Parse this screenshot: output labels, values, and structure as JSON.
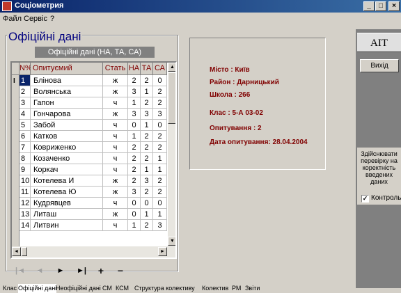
{
  "window": {
    "title": "Соціометрия",
    "min": "_",
    "max": "□",
    "close": "×"
  },
  "menu": [
    "Файл",
    "Сервіс",
    "?"
  ],
  "official": {
    "group_title": "Офіційні дані",
    "subtitle": "Офіційні дані (НА, ТА, СА)",
    "columns": [
      "N%",
      "Опитуємий",
      "Стать",
      "НА",
      "ТА",
      "СА"
    ],
    "current_marker": "I",
    "rows": [
      [
        "1",
        "Блінова",
        "ж",
        "2",
        "2",
        "0"
      ],
      [
        "2",
        "Волянська",
        "ж",
        "3",
        "1",
        "2"
      ],
      [
        "3",
        "Гапон",
        "ч",
        "1",
        "2",
        "2"
      ],
      [
        "4",
        "Гончарова",
        "ж",
        "3",
        "3",
        "3"
      ],
      [
        "5",
        "Забой",
        "ч",
        "0",
        "1",
        "0"
      ],
      [
        "6",
        "Катков",
        "ч",
        "1",
        "2",
        "2"
      ],
      [
        "7",
        "Ковриженко",
        "ч",
        "2",
        "2",
        "2"
      ],
      [
        "8",
        "Козаченко",
        "ч",
        "2",
        "2",
        "1"
      ],
      [
        "9",
        "Коркач",
        "ч",
        "2",
        "1",
        "1"
      ],
      [
        "10",
        "Котелева И",
        "ж",
        "2",
        "3",
        "2"
      ],
      [
        "11",
        "Котелева Ю",
        "ж",
        "3",
        "2",
        "2"
      ],
      [
        "12",
        "Кудрявцев",
        "ч",
        "0",
        "0",
        "0"
      ],
      [
        "13",
        "Литаш",
        "ж",
        "0",
        "1",
        "1"
      ],
      [
        "14",
        "Литвин",
        "ч",
        "1",
        "2",
        "3"
      ]
    ],
    "selected_row": 0
  },
  "navigator": [
    "|◄",
    "◄",
    "►",
    "►|",
    "+",
    "−"
  ],
  "info": {
    "city": "Місто : Київ",
    "district": "Район : Дарницький",
    "school": "Школа : 266",
    "class": "Клас : 5-А 03-02",
    "surveyed": "Опитування : 2",
    "date": "Дата опитування: 28.04.2004"
  },
  "side": {
    "logo": "AIT",
    "exit": "Вихід",
    "verify_text": "Здійснювати перевірку на коректність введених даних",
    "control_label": "Контроль",
    "control_check": "✓"
  },
  "tabs": [
    "Клас",
    "Офіційні дані",
    "Неофіційні дані",
    "СМ",
    "КСМ",
    "Структура колективу",
    "Колектив",
    "РМ",
    "Звіти"
  ],
  "active_tab": 1,
  "colors": {
    "title_bar": "#0a246a",
    "group_title": "#00007f",
    "header_text": "#800000",
    "info_text": "#800000"
  }
}
